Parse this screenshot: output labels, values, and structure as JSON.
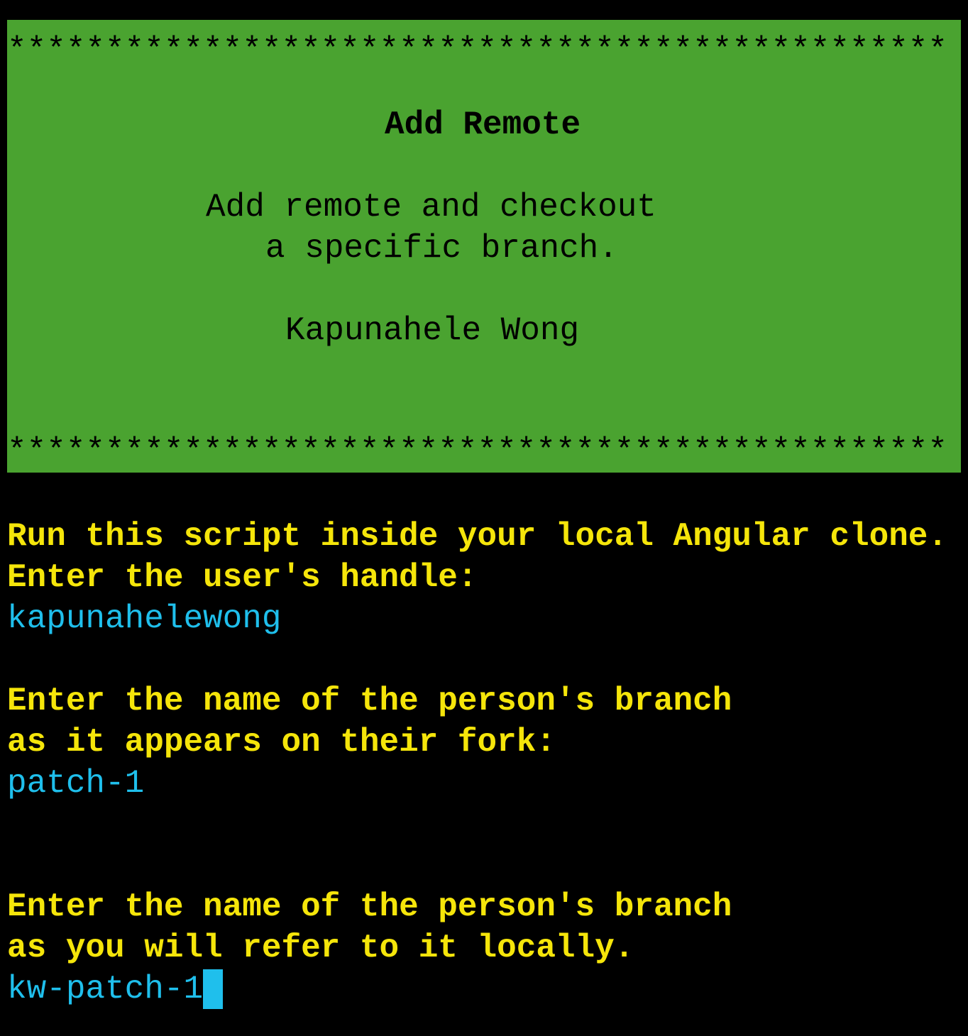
{
  "banner": {
    "stars": "************************************************",
    "title": "Add Remote",
    "description_line1": "Add remote and checkout",
    "description_line2": "a specific branch.",
    "author": "Kapunahele Wong"
  },
  "session": {
    "intro": "Run this script inside your local Angular clone.",
    "handle_prompt": "Enter the user's handle:",
    "handle_value": "kapunahelewong",
    "fork_branch_prompt_line1": "Enter the name of the person's branch",
    "fork_branch_prompt_line2": "as it appears on their fork:",
    "fork_branch_value": "patch-1",
    "local_branch_prompt_line1": "Enter the name of the person's branch",
    "local_branch_prompt_line2": "as you will refer to it locally.",
    "local_branch_value": "kw-patch-1"
  },
  "colors": {
    "background": "#000000",
    "banner": "#4aa330",
    "prompt": "#f5e50a",
    "input": "#1fbfec"
  }
}
